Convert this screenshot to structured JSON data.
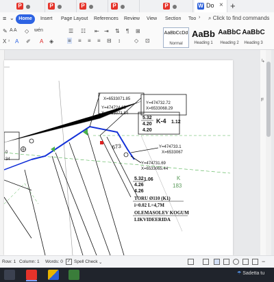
{
  "titlebar": {
    "tabs": [
      {
        "type": "pdf",
        "label": ""
      },
      {
        "type": "pdf",
        "label": ""
      },
      {
        "type": "pdf",
        "label": ""
      },
      {
        "type": "pdf",
        "label": ""
      },
      {
        "type": "pdf",
        "label": ""
      },
      {
        "type": "doc",
        "label": "Do"
      }
    ],
    "new_tab_symbol": "+"
  },
  "menu": {
    "items": [
      "Home",
      "Insert",
      "Page Layout",
      "References",
      "Review",
      "View",
      "Section",
      "Too"
    ],
    "search_placeholder": "Click to find commands"
  },
  "ribbon": {
    "styles": [
      {
        "sample": "AaBbCcDd",
        "name": "Normal"
      },
      {
        "sample": "AaBb",
        "name": "Heading 1"
      },
      {
        "sample": "AaBbC",
        "name": "Heading 2"
      },
      {
        "sample": "AaBbC",
        "name": "Heading 3"
      }
    ]
  },
  "drawing": {
    "labels": {
      "top_coords": "X=6533071.85",
      "y1": "Y=474724.65",
      "x1": "X=6533071.84",
      "y2": "Y=474732.72",
      "x2": "X=6533068.29",
      "elev1a": "5.32",
      "elev1b": "4.20",
      "elev1c": "4.20",
      "k4": "K-4",
      "k4val": "1.12",
      "y3": "Y=474733.1",
      "x3": "X=6533067",
      "y4": "Y=474731.69",
      "x4": "X=6533065.44",
      "elev2a": "5.32",
      "elev2b": "4.26",
      "elev2c": "4.26",
      "k5val": "1.06",
      "pipe": "TORU Ø110 (K1)",
      "slope": "i=0.02 L=4,7M",
      "note1": "OLEMASOLEV KOGUM",
      "note2": "LIKVIDEERIDA",
      "num673": "673",
      "green1": "K",
      "green2": "183",
      "left1": "34",
      "left2": "0"
    }
  },
  "status": {
    "page": "",
    "row": "Row: 1",
    "column": "Column: 1",
    "words": "Words: 0",
    "spell": "Spell Check"
  },
  "taskbar": {
    "weather": "Sadetta tu"
  }
}
